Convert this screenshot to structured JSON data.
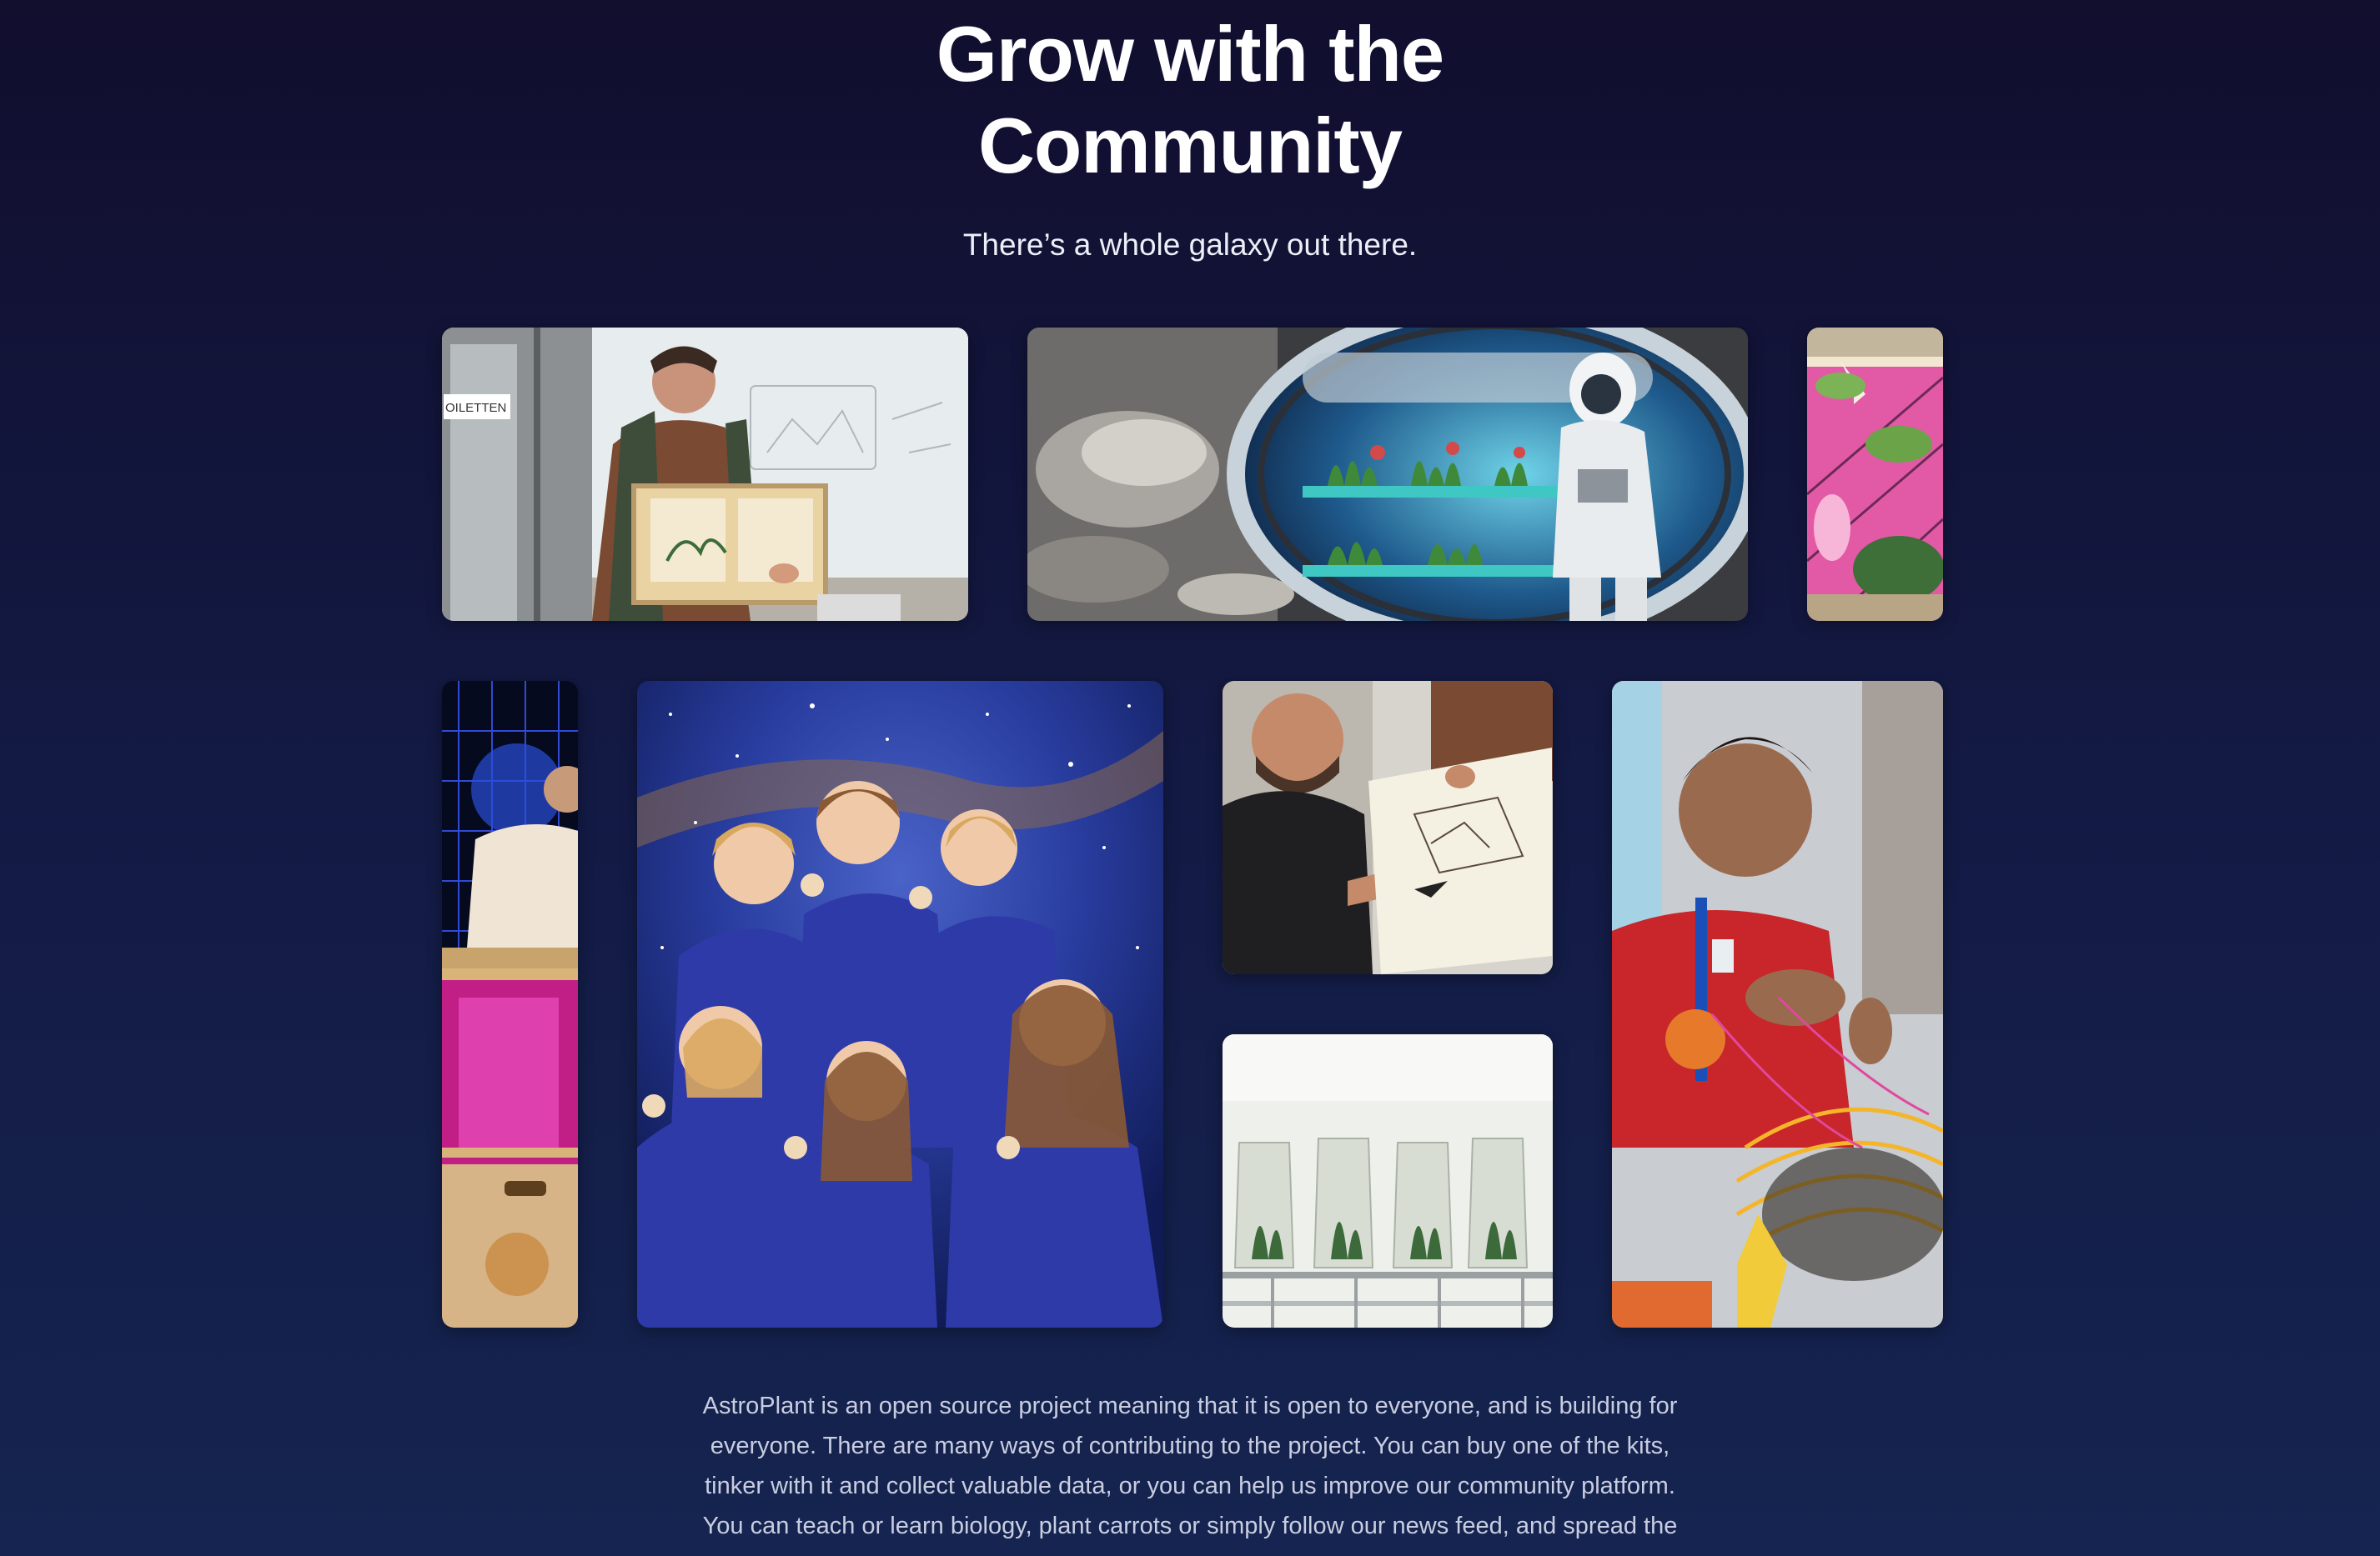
{
  "section": {
    "title_line1": "Grow with the",
    "title_line2": "Community",
    "subtitle": "There’s a whole galaxy out there.",
    "description": "AstroPlant is an open source project meaning that it is open to everyone, and is building for everyone. There are many ways of contributing to the project. You can buy one of the kits, tinker with it and collect valuable data, or you can help us improve our community platform. You can teach or learn biology, plant carrots or simply follow our news feed, and spread the"
  },
  "photo1": {
    "sign_text": "OILETTEN"
  },
  "colors": {
    "background_top": "#110e2e",
    "background_bottom": "#152450",
    "title": "#ffffff",
    "body_text": "#c9cde0",
    "accent_pink": "#e0489e",
    "accent_teal": "#3fc7c4"
  }
}
